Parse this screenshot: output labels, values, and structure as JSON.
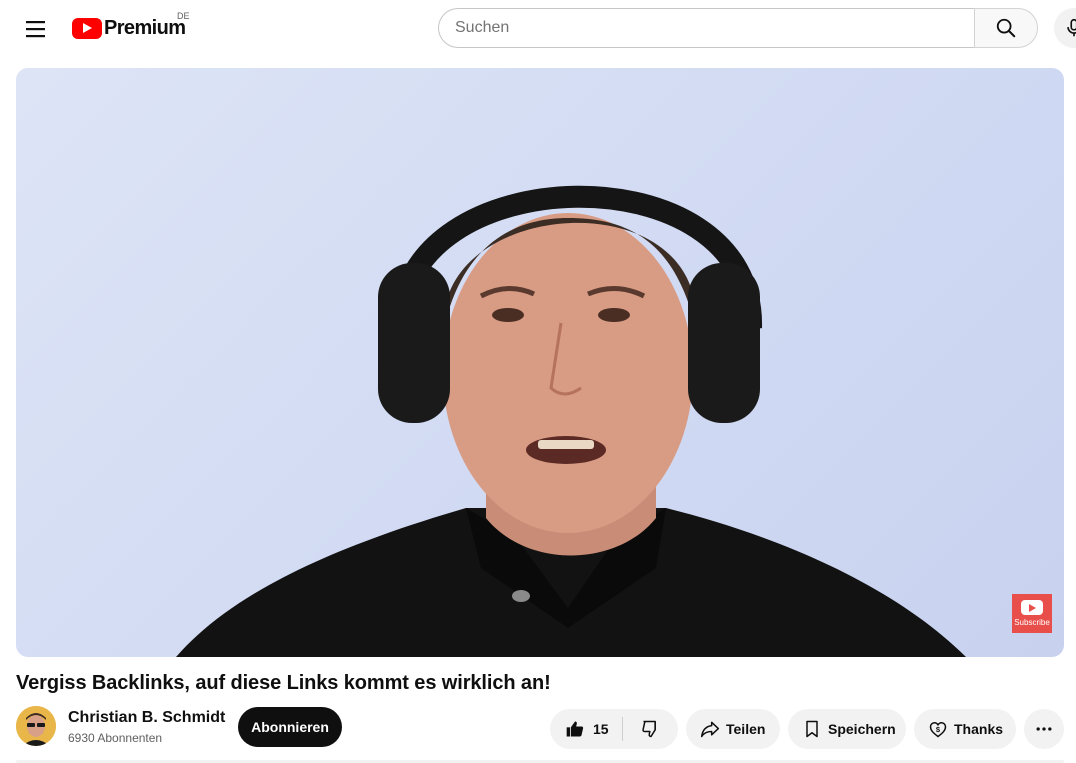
{
  "header": {
    "logo_text": "Premium",
    "country_code": "DE",
    "search_placeholder": "Suchen",
    "search_value": ""
  },
  "player": {
    "watermark_label": "Subscribe"
  },
  "video": {
    "title": "Vergiss Backlinks, auf diese Links kommt es wirklich an!"
  },
  "owner": {
    "channel_name": "Christian B. Schmidt",
    "subscribers": "6930 Abonnenten",
    "subscribe_label": "Abonnieren"
  },
  "actions": {
    "like_count": "15",
    "share_label": "Teilen",
    "save_label": "Speichern",
    "thanks_label": "Thanks"
  },
  "icons": [
    "menu-icon",
    "youtube-play-icon",
    "search-icon",
    "mic-icon",
    "thumbs-up-icon",
    "thumbs-down-icon",
    "share-arrow-icon",
    "bookmark-icon",
    "thanks-heart-icon",
    "more-dots-icon"
  ],
  "colors": {
    "brand_red": "#ff0000",
    "subscribe_button_bg": "#0f0f0f",
    "pill_bg": "#f2f2f2",
    "watermark_red": "#e84f4a"
  }
}
